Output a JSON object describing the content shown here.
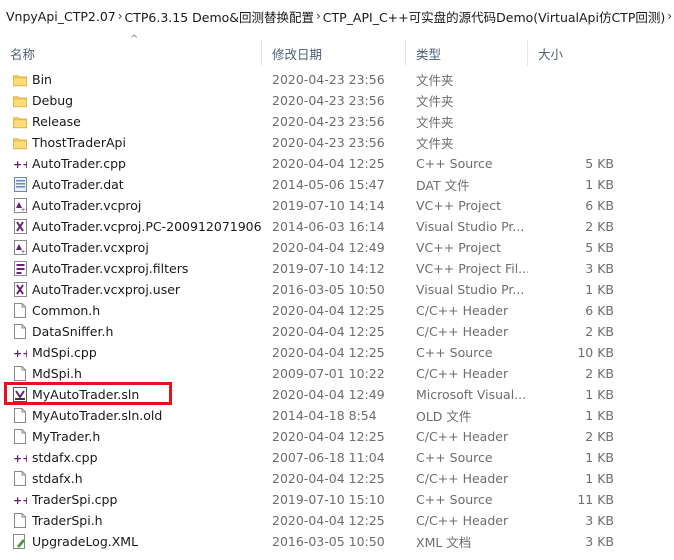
{
  "breadcrumb": [
    "VnpyApi_CTP2.07",
    "CTP6.3.15 Demo&回测替换配置",
    "CTP_API_C++可实盘的源代码Demo(VirtualApi仿CTP回测)"
  ],
  "breadcrumb_separator": "›",
  "columns": {
    "name": "名称",
    "date": "修改日期",
    "type": "类型",
    "size": "大小"
  },
  "sort_indicator": "^",
  "highlight_color": "#e0141a",
  "files": [
    {
      "name": "Bin",
      "date": "2020-04-23 23:56",
      "type": "文件夹",
      "size": "",
      "icon": "folder-icon"
    },
    {
      "name": "Debug",
      "date": "2020-04-23 23:56",
      "type": "文件夹",
      "size": "",
      "icon": "folder-icon"
    },
    {
      "name": "Release",
      "date": "2020-04-23 23:56",
      "type": "文件夹",
      "size": "",
      "icon": "folder-icon"
    },
    {
      "name": "ThostTraderApi",
      "date": "2020-04-23 23:56",
      "type": "文件夹",
      "size": "",
      "icon": "folder-icon"
    },
    {
      "name": "AutoTrader.cpp",
      "date": "2020-04-04 12:25",
      "type": "C++ Source",
      "size": "5 KB",
      "icon": "cpp-file-icon"
    },
    {
      "name": "AutoTrader.dat",
      "date": "2014-05-06 15:47",
      "type": "DAT 文件",
      "size": "1 KB",
      "icon": "dat-file-icon"
    },
    {
      "name": "AutoTrader.vcproj",
      "date": "2019-07-10 14:14",
      "type": "VC++ Project",
      "size": "6 KB",
      "icon": "vcproj-file-icon"
    },
    {
      "name": "AutoTrader.vcproj.PC-200912071906....",
      "date": "2014-06-03 16:14",
      "type": "Visual Studio Pr...",
      "size": "2 KB",
      "icon": "vs-file-icon"
    },
    {
      "name": "AutoTrader.vcxproj",
      "date": "2020-04-04 12:49",
      "type": "VC++ Project",
      "size": "5 KB",
      "icon": "vcproj-file-icon"
    },
    {
      "name": "AutoTrader.vcxproj.filters",
      "date": "2019-07-10 14:12",
      "type": "VC++ Project Fil...",
      "size": "3 KB",
      "icon": "filters-file-icon"
    },
    {
      "name": "AutoTrader.vcxproj.user",
      "date": "2016-03-05 10:50",
      "type": "Visual Studio Pr...",
      "size": "1 KB",
      "icon": "vs-file-icon"
    },
    {
      "name": "Common.h",
      "date": "2020-04-04 12:25",
      "type": "C/C++ Header",
      "size": "6 KB",
      "icon": "header-file-icon"
    },
    {
      "name": "DataSniffer.h",
      "date": "2020-04-04 12:25",
      "type": "C/C++ Header",
      "size": "2 KB",
      "icon": "header-file-icon"
    },
    {
      "name": "MdSpi.cpp",
      "date": "2020-04-04 12:25",
      "type": "C++ Source",
      "size": "10 KB",
      "icon": "cpp-file-icon"
    },
    {
      "name": "MdSpi.h",
      "date": "2009-07-01 10:22",
      "type": "C/C++ Header",
      "size": "2 KB",
      "icon": "header-file-icon"
    },
    {
      "name": "MyAutoTrader.sln",
      "date": "2020-04-04 12:49",
      "type": "Microsoft Visual...",
      "size": "1 KB",
      "icon": "sln-file-icon"
    },
    {
      "name": "MyAutoTrader.sln.old",
      "date": "2014-04-18 8:54",
      "type": "OLD 文件",
      "size": "1 KB",
      "icon": "blank-file-icon"
    },
    {
      "name": "MyTrader.h",
      "date": "2020-04-04 12:25",
      "type": "C/C++ Header",
      "size": "2 KB",
      "icon": "header-file-icon"
    },
    {
      "name": "stdafx.cpp",
      "date": "2007-06-18 11:04",
      "type": "C++ Source",
      "size": "1 KB",
      "icon": "cpp-file-icon"
    },
    {
      "name": "stdafx.h",
      "date": "2020-04-04 12:25",
      "type": "C/C++ Header",
      "size": "1 KB",
      "icon": "header-file-icon"
    },
    {
      "name": "TraderSpi.cpp",
      "date": "2019-07-10 15:10",
      "type": "C++ Source",
      "size": "11 KB",
      "icon": "cpp-file-icon"
    },
    {
      "name": "TraderSpi.h",
      "date": "2020-04-04 12:25",
      "type": "C/C++ Header",
      "size": "3 KB",
      "icon": "header-file-icon"
    },
    {
      "name": "UpgradeLog.XML",
      "date": "2016-03-05 10:50",
      "type": "XML 文档",
      "size": "3 KB",
      "icon": "xml-file-icon"
    }
  ]
}
